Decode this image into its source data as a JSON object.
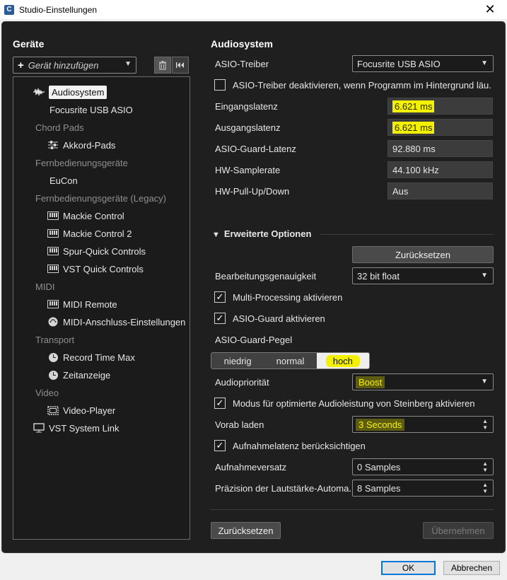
{
  "window": {
    "title": "Studio-Einstellungen",
    "app_icon": "cubase-icon",
    "close_glyph": "✕"
  },
  "devices": {
    "heading": "Geräte",
    "add_device_placeholder": "Gerät hinzufügen",
    "tree": [
      {
        "type": "item",
        "label": "Audiosystem",
        "icon": "waveform-icon",
        "selected": true
      },
      {
        "type": "item",
        "label": "Focusrite USB ASIO",
        "icon": null
      },
      {
        "type": "category",
        "label": "Chord Pads"
      },
      {
        "type": "item",
        "label": "Akkord-Pads",
        "icon": "sliders-icon"
      },
      {
        "type": "category",
        "label": "Fernbedienungsgeräte"
      },
      {
        "type": "item",
        "label": "EuCon",
        "icon": null
      },
      {
        "type": "category",
        "label": "Fernbedienungsgeräte (Legacy)"
      },
      {
        "type": "item",
        "label": "Mackie Control",
        "icon": "keyboard-icon"
      },
      {
        "type": "item",
        "label": "Mackie Control 2",
        "icon": "keyboard-icon"
      },
      {
        "type": "item",
        "label": "Spur-Quick Controls",
        "icon": "keyboard-icon"
      },
      {
        "type": "item",
        "label": "VST Quick Controls",
        "icon": "keyboard-icon"
      },
      {
        "type": "category",
        "label": "MIDI"
      },
      {
        "type": "item",
        "label": "MIDI Remote",
        "icon": "keyboard-icon"
      },
      {
        "type": "item",
        "label": "MIDI-Anschluss-Einstellungen",
        "icon": "midi-port-icon"
      },
      {
        "type": "category",
        "label": "Transport"
      },
      {
        "type": "item",
        "label": "Record Time Max",
        "icon": "clock-icon"
      },
      {
        "type": "item",
        "label": "Zeitanzeige",
        "icon": "clock-icon"
      },
      {
        "type": "category",
        "label": "Video"
      },
      {
        "type": "item",
        "label": "Video-Player",
        "icon": "film-icon"
      },
      {
        "type": "item",
        "label": "VST System Link",
        "icon": "monitor-icon",
        "top_level": true
      }
    ]
  },
  "audiosystem": {
    "heading": "Audiosystem",
    "asio_driver": {
      "label": "ASIO-Treiber",
      "value": "Focusrite USB ASIO"
    },
    "deactivate_bg": {
      "label": "ASIO-Treiber deaktivieren, wenn Programm im Hintergrund läu.",
      "checked": false
    },
    "readouts": [
      {
        "label": "Eingangslatenz",
        "value": "6.621 ms",
        "highlight": true
      },
      {
        "label": "Ausgangslatenz",
        "value": "6.621 ms",
        "highlight": true
      },
      {
        "label": "ASIO-Guard-Latenz",
        "value": "92.880 ms",
        "highlight": false
      },
      {
        "label": "HW-Samplerate",
        "value": "44.100 kHz",
        "highlight": false
      },
      {
        "label": "HW-Pull-Up/Down",
        "value": "Aus",
        "highlight": false
      }
    ],
    "advanced": {
      "heading": "Erweiterte Optionen",
      "reset_label": "Zurücksetzen",
      "precision": {
        "label": "Bearbeitungsgenauigkeit",
        "value": "32 bit float"
      },
      "multiprocessing": {
        "label": "Multi-Processing aktivieren",
        "checked": true
      },
      "asio_guard": {
        "label": "ASIO-Guard aktivieren",
        "checked": true
      },
      "asio_guard_level": {
        "label": "ASIO-Guard-Pegel",
        "options": [
          "niedrig",
          "normal",
          "hoch"
        ],
        "selected": "hoch"
      },
      "audio_priority": {
        "label": "Audiopriorität",
        "value": "Boost"
      },
      "steinberg_mode": {
        "label": "Modus für optimierte Audioleistung von Steinberg aktivieren",
        "checked": true
      },
      "preload": {
        "label": "Vorab laden",
        "value": "3 Seconds"
      },
      "record_latency": {
        "label": "Aufnahmelatenz berücksichtigen",
        "checked": true
      },
      "record_offset": {
        "label": "Aufnahmeversatz",
        "value": "0 Samples"
      },
      "volume_precision": {
        "label": "Präzision der Lautstärke-Automa.",
        "value": "8 Samples"
      }
    },
    "footer": {
      "reset_label": "Zurücksetzen",
      "apply_label": "Übernehmen"
    }
  },
  "dialog_buttons": {
    "ok_label": "OK",
    "cancel_label": "Abbrechen"
  },
  "colors": {
    "highlight": "#f3f000",
    "panel_bg": "#1f1f1f",
    "readout_bg": "#3c3c3c"
  }
}
